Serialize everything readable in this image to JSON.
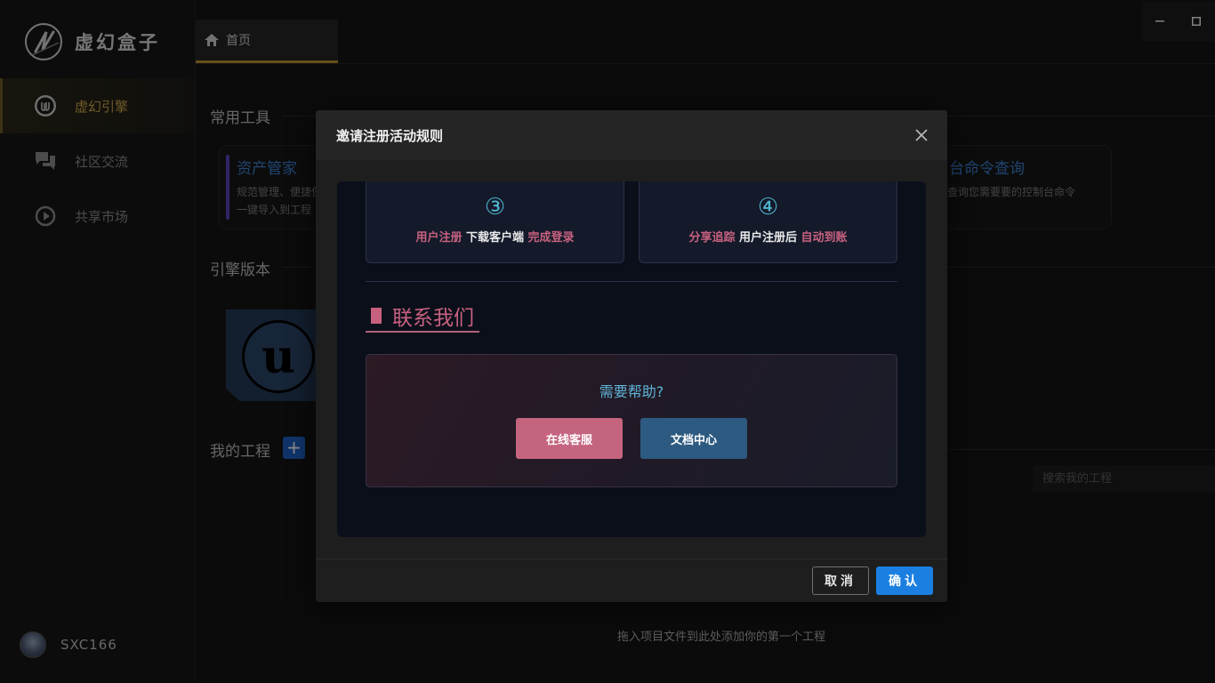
{
  "app": {
    "name": "虚幻盒子"
  },
  "sidebar": {
    "items": [
      {
        "label": "虚幻引擎",
        "icon": "unreal-engine-icon",
        "active": true
      },
      {
        "label": "社区交流",
        "icon": "chat-bubbles-icon",
        "active": false
      },
      {
        "label": "共享市场",
        "icon": "market-play-icon",
        "active": false
      }
    ],
    "user": {
      "name": "SXC166"
    }
  },
  "tabs": [
    {
      "label": "首页",
      "icon": "home-icon"
    }
  ],
  "main": {
    "common_tools_title": "常用工具",
    "tools": [
      {
        "title": "资产管家",
        "desc_line1": "规范管理、便捷使",
        "desc_line2": "一键导入到工程"
      },
      {
        "title": "台命令查询",
        "desc_line1": "查询您需要要的控制台命令"
      }
    ],
    "engine_versions_title": "引擎版本",
    "my_projects_title": "我的工程",
    "add_label": "+",
    "search_placeholder": "搜索我的工程",
    "drop_hint": "拖入项目文件到此处添加你的第一个工程"
  },
  "modal": {
    "title": "邀请注册活动规则",
    "steps": [
      {
        "num": "③",
        "hl1": "用户注册",
        "wt": "下载客户端",
        "hl2": "完成登录"
      },
      {
        "num": "④",
        "hl1": "分享追踪",
        "wt": "用户注册后",
        "hl2": "自动到账"
      }
    ],
    "contact_title": "联系我们",
    "help_title": "需要帮助?",
    "online_service_label": "在线客服",
    "docs_center_label": "文档中心",
    "cancel_label": "取消",
    "confirm_label": "确认"
  },
  "colors": {
    "accent_gold": "#c9a54a",
    "highlight_pink": "#c7617f",
    "link_blue": "#3c7ecf",
    "confirm_blue": "#1a7fe0",
    "help_cyan": "#5fb3d6"
  }
}
